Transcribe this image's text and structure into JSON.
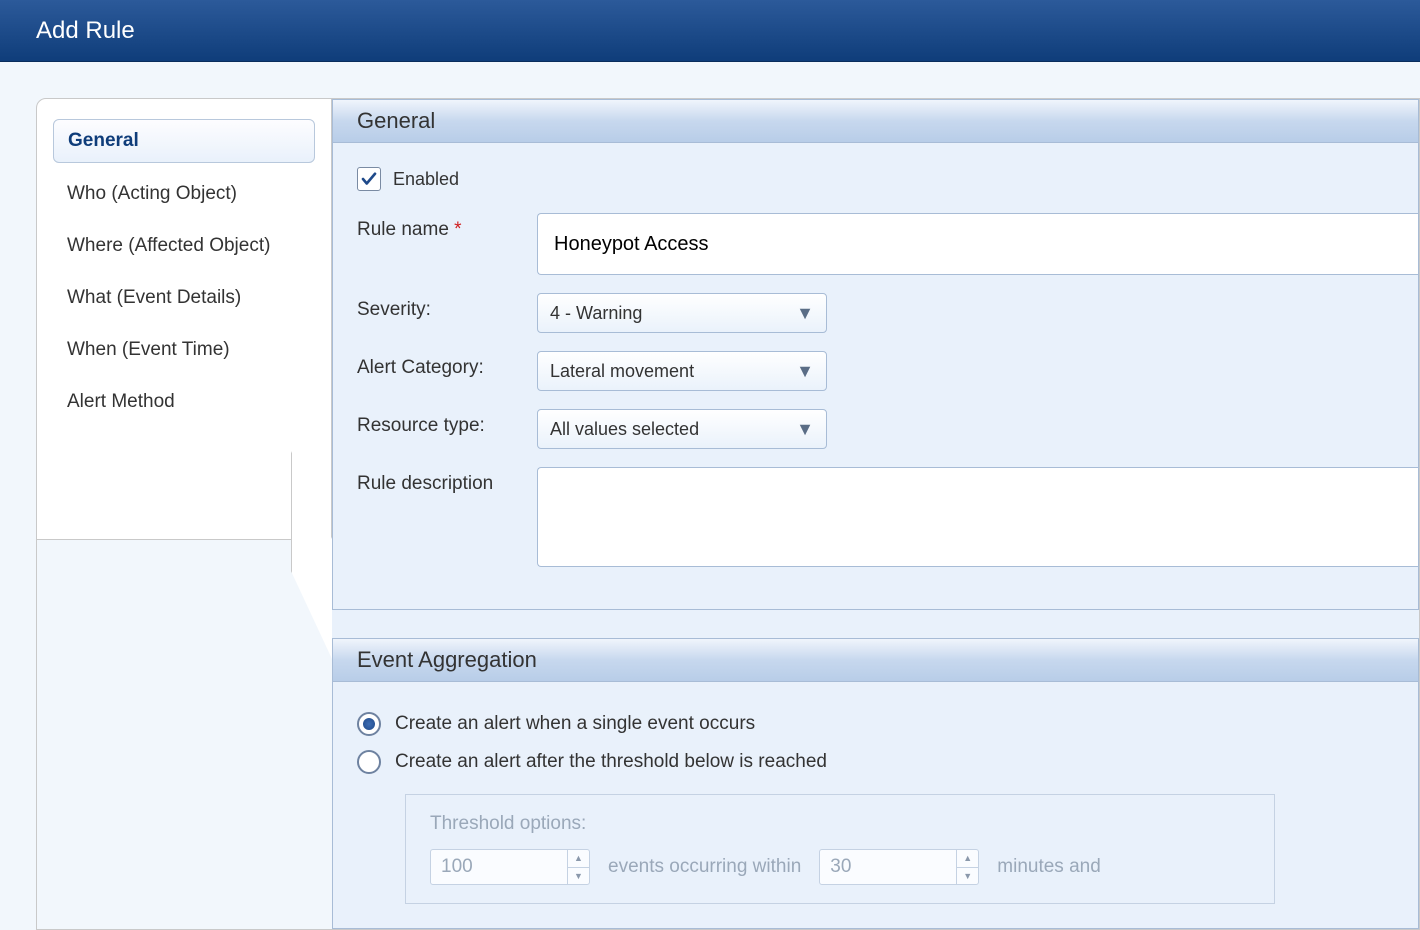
{
  "titlebar": {
    "title": "Add Rule"
  },
  "sidebar": {
    "tabs": [
      {
        "label": "General",
        "active": true
      },
      {
        "label": "Who (Acting Object)",
        "active": false
      },
      {
        "label": "Where (Affected Object)",
        "active": false
      },
      {
        "label": "What (Event Details)",
        "active": false
      },
      {
        "label": "When (Event Time)",
        "active": false
      },
      {
        "label": "Alert Method",
        "active": false
      }
    ]
  },
  "general": {
    "section_title": "General",
    "enabled_label": "Enabled",
    "enabled_checked": true,
    "rule_name_label": "Rule name",
    "rule_name_value": "Honeypot Access",
    "severity_label": "Severity:",
    "severity_value": "4 - Warning",
    "alert_category_label": "Alert Category:",
    "alert_category_value": "Lateral movement",
    "resource_type_label": "Resource type:",
    "resource_type_value": "All values selected",
    "rule_description_label": "Rule description",
    "rule_description_value": ""
  },
  "aggregation": {
    "section_title": "Event Aggregation",
    "option_single": "Create an alert when a single event occurs",
    "option_threshold": "Create an alert after the threshold below is reached",
    "selected": "single",
    "threshold_label": "Threshold options:",
    "threshold_count": "100",
    "threshold_text_mid": "events occurring within",
    "threshold_minutes": "30",
    "threshold_text_end": "minutes and"
  }
}
